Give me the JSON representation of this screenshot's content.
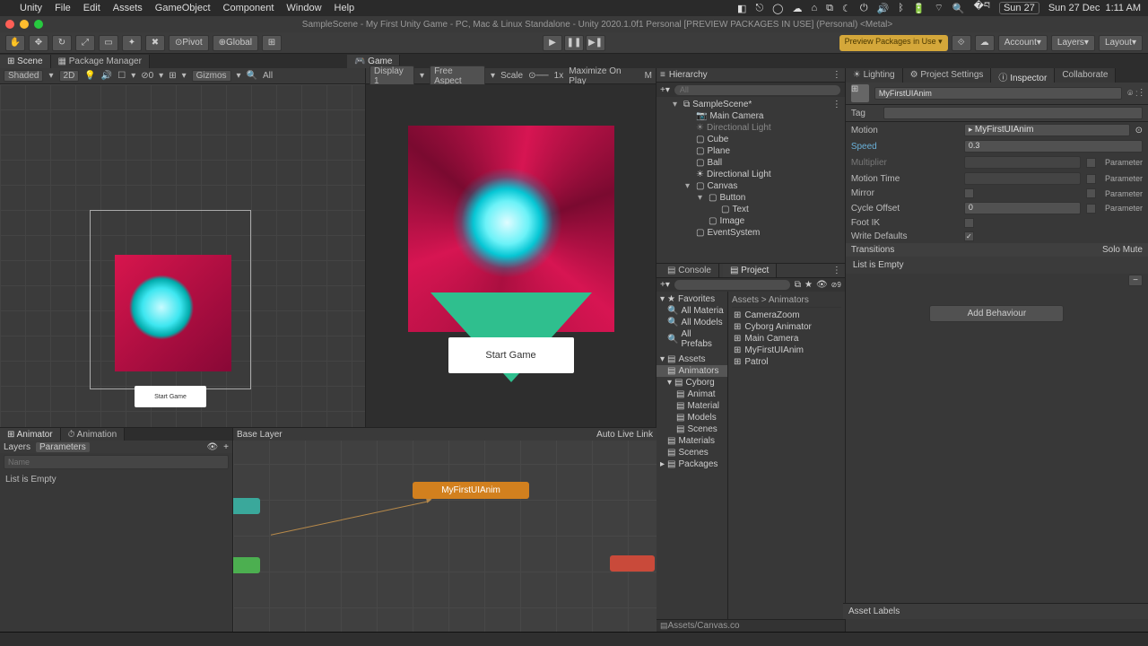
{
  "mac_menu": [
    "Unity",
    "File",
    "Edit",
    "Assets",
    "GameObject",
    "Component",
    "Window",
    "Help"
  ],
  "mac_date": "Sun 27",
  "mac_time": "1:11 AM",
  "mac_day": "Sun 27 Dec",
  "title": "SampleScene - My First Unity Game - PC, Mac & Linux Standalone - Unity 2020.1.0f1 Personal [PREVIEW PACKAGES IN USE] (Personal) <Metal>",
  "toolbar": {
    "pivot": "Pivot",
    "global": "Global",
    "preview": "Preview Packages in Use ▾",
    "account": "Account",
    "layers": "Layers",
    "layout": "Layout"
  },
  "tabs_left": [
    {
      "l": "Scene",
      "a": true
    },
    {
      "l": "Package Manager",
      "a": false
    }
  ],
  "tabs_game": [
    {
      "l": "Game",
      "a": true
    }
  ],
  "scene_toolbar": {
    "shaded": "Shaded",
    "mode": "2D",
    "gizmos": "Gizmos",
    "all": "All"
  },
  "game_toolbar": {
    "display": "Display 1",
    "aspect": "Free Aspect",
    "scale": "Scale",
    "scaleval": "1x",
    "max": "Maximize On Play",
    "mute": "M"
  },
  "scene_button": "Start Game",
  "game_button": "Start Game",
  "hierarchy": {
    "title": "Hierarchy",
    "search": "All",
    "root": "SampleScene*",
    "items": [
      "Main Camera",
      "Directional Light",
      "Cube",
      "Plane",
      "Ball",
      "Directional Light",
      "Canvas",
      "Button",
      "Text",
      "Image",
      "EventSystem"
    ]
  },
  "console_tab": "Console",
  "project_tab": "Project",
  "project": {
    "favorites": "Favorites",
    "fav_items": [
      "All Materia",
      "All Models",
      "All Prefabs"
    ],
    "assets": "Assets",
    "asset_tree": [
      "Animators",
      "Cyborg",
      "Animat",
      "Material",
      "Models",
      "Scenes",
      "Materials",
      "Scenes"
    ],
    "packages": "Packages",
    "breadcrumb": "Assets > Animators",
    "list": [
      "CameraZoom",
      "Cyborg Animator",
      "Main Camera",
      "MyFirstUIAnim",
      "Patrol"
    ],
    "footer": "Assets/Canvas.co"
  },
  "animator": {
    "tab1": "Animator",
    "tab2": "Animation",
    "layers": "Layers",
    "params": "Parameters",
    "name_ph": "Name",
    "empty": "List is Empty",
    "base": "Base Layer",
    "auto": "Auto Live Link",
    "node": "MyFirstUIAnim"
  },
  "inspector": {
    "tabs": [
      "Lighting",
      "Project Settings",
      "Inspector",
      "Collaborate"
    ],
    "name": "MyFirstUIAnim",
    "tag": "Tag",
    "rows": [
      {
        "label": "Motion",
        "value": "MyFirstUIAnim",
        "obj": true
      },
      {
        "label": "Speed",
        "value": "0.3"
      },
      {
        "label": "Multiplier",
        "dim": true,
        "param": true
      },
      {
        "label": "Motion Time",
        "param": true
      },
      {
        "label": "Mirror",
        "cb": true,
        "param": true
      },
      {
        "label": "Cycle Offset",
        "value": "0",
        "param": true
      },
      {
        "label": "Foot IK",
        "cb": true
      },
      {
        "label": "Write Defaults",
        "cb": true,
        "checked": true
      }
    ],
    "transitions": "Transitions",
    "solo": "Solo",
    "mute": "Mute",
    "empty": "List is Empty",
    "add": "Add Behaviour",
    "asset_labels": "Asset Labels",
    "parameter": "Parameter"
  }
}
